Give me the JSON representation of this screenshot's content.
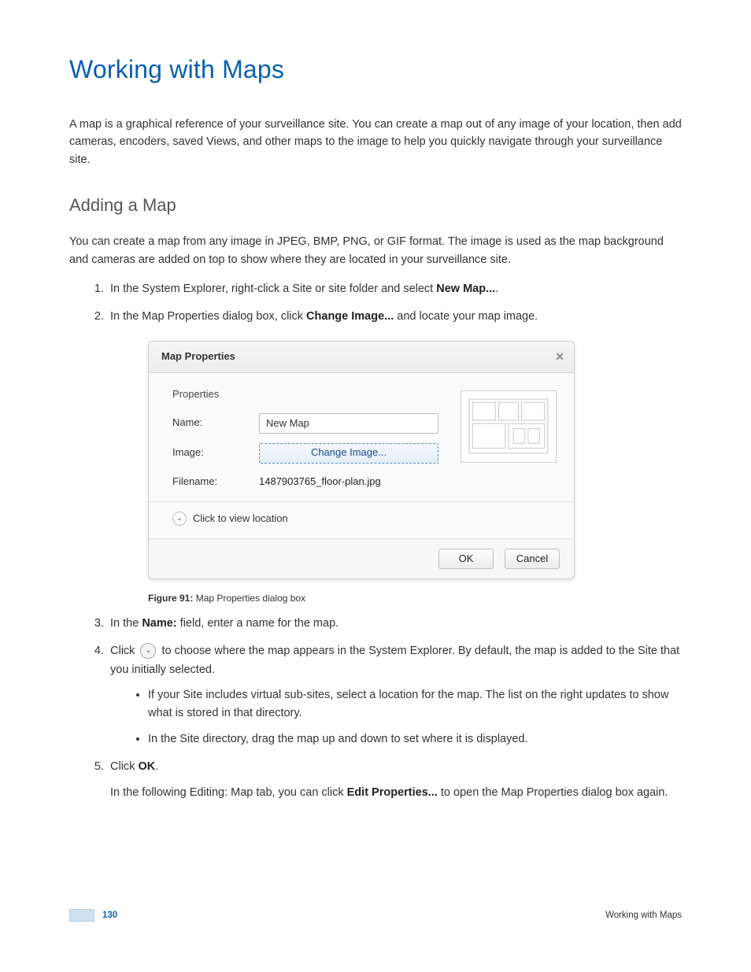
{
  "h1": "Working with Maps",
  "intro": "A map is a graphical reference of your surveillance site. You can create a map out of any image of your location, then add cameras, encoders, saved Views, and other maps to the image to help you quickly navigate through your surveillance site.",
  "h2": "Adding a Map",
  "p2": "You can create a map from any image in JPEG, BMP, PNG, or GIF format. The image is used as the map background and cameras are added on top to show where they are located in your surveillance site.",
  "step1_a": "In the System Explorer, right-click a Site or site folder and select ",
  "step1_b": "New Map...",
  "step1_c": ".",
  "step2_a": "In the Map Properties dialog box, click ",
  "step2_b": "Change Image...",
  "step2_c": " and locate your map image.",
  "dialog": {
    "title": "Map Properties",
    "section": "Properties",
    "name_lbl": "Name:",
    "name_val": "New Map",
    "image_lbl": "Image:",
    "change_btn": "Change Image...",
    "file_lbl": "Filename:",
    "file_val": "1487903765_floor-plan.jpg",
    "expand": "Click to view location",
    "ok": "OK",
    "cancel": "Cancel"
  },
  "figcap_no": "Figure 91:",
  "figcap_txt": " Map Properties dialog box",
  "step3_a": "In the ",
  "step3_b": "Name:",
  "step3_c": " field, enter a name for the map.",
  "step4_a": "Click ",
  "step4_b": " to choose where the map appears in the System Explorer. By default, the map is added to the Site that you initially selected.",
  "step4_s1": "If your Site includes virtual sub-sites, select a location for the map. The list on the right updates to show what is stored in that directory.",
  "step4_s2": "In the Site directory, drag the map up and down to set where it is displayed.",
  "step5_a": "Click ",
  "step5_b": "OK",
  "step5_c": ".",
  "step5_p2_a": "In the following Editing: Map tab, you can click ",
  "step5_p2_b": "Edit Properties...",
  "step5_p2_c": " to open the Map Properties dialog box again.",
  "footer": {
    "page": "130",
    "section": "Working with Maps"
  }
}
